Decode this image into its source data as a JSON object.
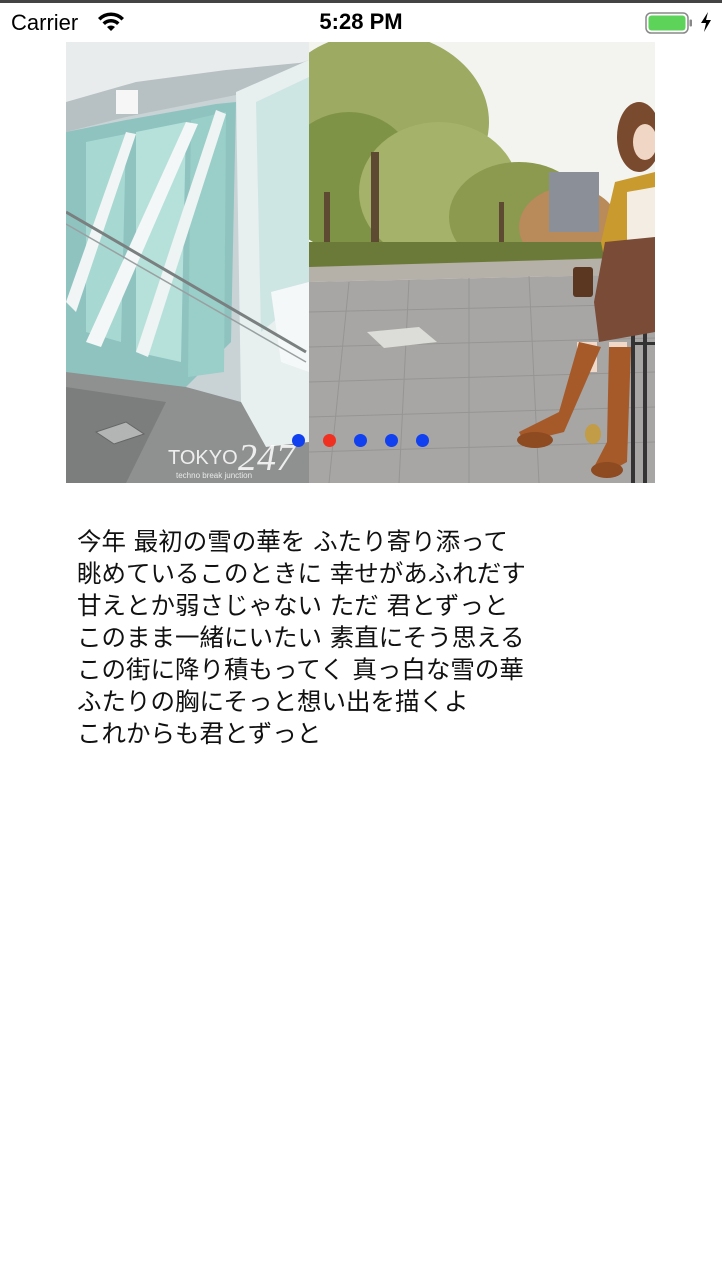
{
  "status_bar": {
    "carrier": "Carrier",
    "time": "5:28 PM",
    "wifi_icon": "wifi-icon",
    "battery_icon": "battery-icon",
    "charging_icon": "bolt-icon",
    "battery_color": "#5dd35a"
  },
  "banner": {
    "watermark_left": "TOKYO",
    "watermark_right": "247",
    "watermark_sub": "techno break junction",
    "page_indicator": {
      "count": 5,
      "current_index": 1,
      "active_color": "#f03020",
      "inactive_color": "#1040f0"
    }
  },
  "lyrics": {
    "lines": [
      "今年 最初の雪の華を ふたり寄り添って",
      "眺めているこのときに 幸せがあふれだす",
      "甘えとか弱さじゃない ただ 君とずっと",
      "このまま一緒にいたい 素直にそう思える",
      "この街に降り積もってく 真っ白な雪の華",
      "ふたりの胸にそっと想い出を描くよ",
      "これからも君とずっと"
    ]
  }
}
